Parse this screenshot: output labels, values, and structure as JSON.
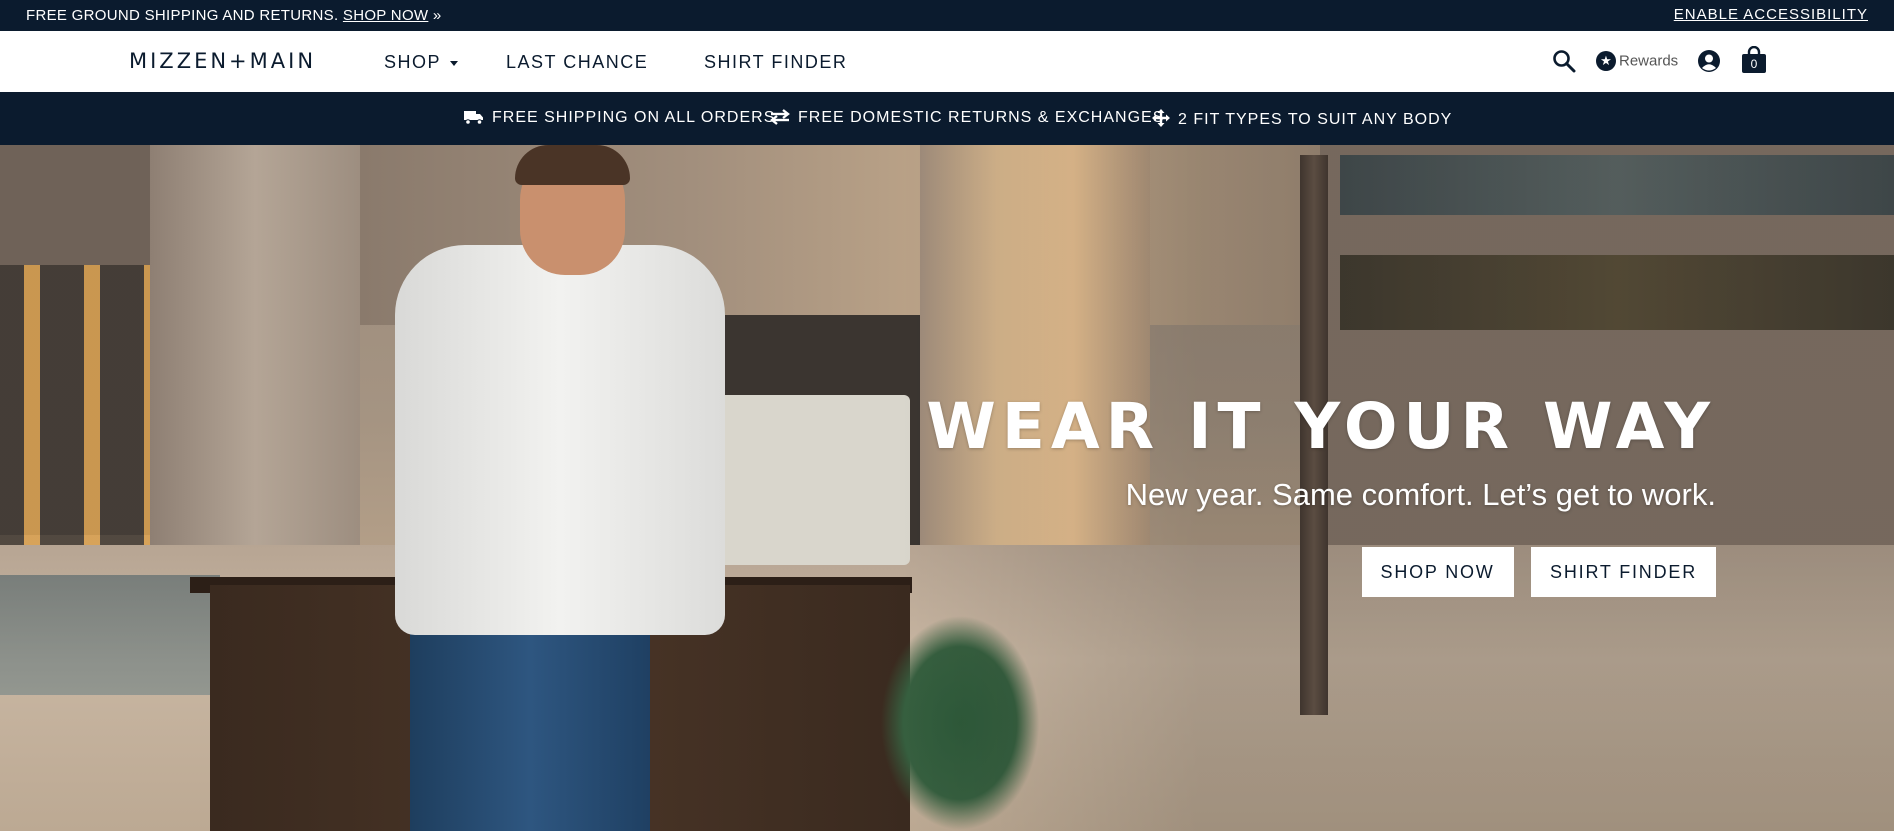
{
  "top_bar": {
    "promo_text": "FREE GROUND SHIPPING AND RETURNS.",
    "promo_link": "SHOP NOW",
    "promo_suffix": "»",
    "accessibility": "ENABLE ACCESSIBILITY"
  },
  "nav": {
    "logo": "MIZZEN+MAIN",
    "items": [
      {
        "label": "SHOP"
      },
      {
        "label": "LAST CHANCE"
      },
      {
        "label": "SHIRT FINDER"
      }
    ],
    "rewards_label": "Rewards",
    "cart_count": "0",
    "icons": {
      "search": "search-icon",
      "rewards": "star-icon",
      "account": "account-icon",
      "cart": "shopping-bag-icon"
    }
  },
  "benefits": [
    {
      "icon": "truck-icon",
      "label": "FREE SHIPPING ON ALL ORDERS"
    },
    {
      "icon": "exchange-arrows-icon",
      "label": "FREE DOMESTIC RETURNS & EXCHANGES"
    },
    {
      "icon": "move-arrows-icon",
      "label": "2 FIT TYPES TO SUIT ANY BODY"
    }
  ],
  "hero": {
    "title": "WEAR IT YOUR WAY",
    "subtitle": "New year. Same comfort. Let’s get to work.",
    "buttons": [
      {
        "label": "SHOP NOW"
      },
      {
        "label": "SHIRT FINDER"
      }
    ]
  },
  "colors": {
    "navy": "#0b1b2e",
    "white": "#ffffff"
  }
}
